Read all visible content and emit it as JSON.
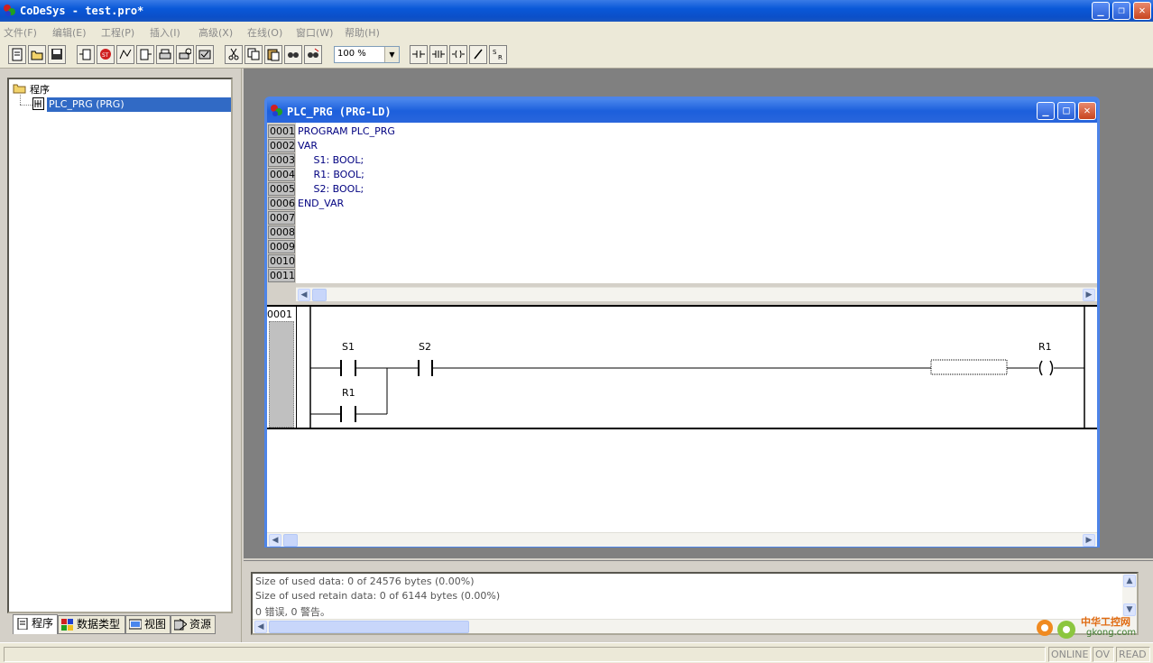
{
  "window": {
    "title": "CoDeSys - test.pro*",
    "minimize_label": "_",
    "restore_label": "❐",
    "close_label": "✕"
  },
  "menu": [
    {
      "label": "文件(F)"
    },
    {
      "label": "编辑(E)"
    },
    {
      "label": "工程(P)"
    },
    {
      "label": "插入(I)"
    },
    {
      "label": "高级(X)"
    },
    {
      "label": "在线(O)"
    },
    {
      "label": "窗口(W)"
    },
    {
      "label": "帮助(H)"
    }
  ],
  "toolbar": {
    "zoom_value": "100 %",
    "buttons": [
      "new-icon",
      "open-icon",
      "save-icon",
      "login-icon",
      "stop-icon",
      "run-icon",
      "logout-icon",
      "print-icon",
      "print-preview-icon",
      "compile-icon",
      "cut-icon",
      "copy-icon",
      "paste-icon",
      "find-icon",
      "replace-icon",
      "contact-icon",
      "parallel-contact-icon",
      "coil-icon",
      "negate-icon",
      "set-reset-icon"
    ]
  },
  "tree": {
    "root_label": "程序",
    "child_label": "PLC_PRG (PRG)"
  },
  "tabs": [
    {
      "label": "程序",
      "icon": "document-icon"
    },
    {
      "label": "数据类型",
      "icon": "datatype-icon"
    },
    {
      "label": "视图",
      "icon": "visualization-icon"
    },
    {
      "label": "资源",
      "icon": "resources-icon"
    }
  ],
  "editor": {
    "title": "PLC_PRG  (PRG-LD)",
    "line_numbers": [
      "0001",
      "0002",
      "0003",
      "0004",
      "0005",
      "0006",
      "0007",
      "0008",
      "0009",
      "0010",
      "0011"
    ],
    "code_lines": [
      "PROGRAM PLC_PRG",
      "VAR",
      "     S1: BOOL;",
      "     R1: BOOL;",
      "     S2: BOOL;",
      "END_VAR"
    ]
  },
  "ladder": {
    "network_number": "0001",
    "contact_s1": "S1",
    "contact_s2": "S2",
    "contact_r1": "R1",
    "coil_r1": "R1"
  },
  "messages": [
    "Size of used data: 0 of 24576 bytes (0.00%)",
    "Size of used retain data: 0 of 6144 bytes (0.00%)",
    "0 错误, 0 警告。"
  ],
  "status": {
    "online": "ONLINE",
    "ov": "OV",
    "read": "READ"
  },
  "watermark": {
    "line1": "中华工控网",
    "line2": "gkong.com"
  }
}
